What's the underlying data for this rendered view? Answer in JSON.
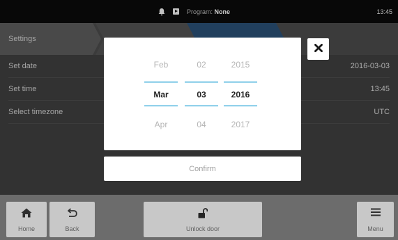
{
  "status_bar": {
    "program_label": "Program:",
    "program_value": "None",
    "time": "13:45",
    "icons": [
      "bell-icon",
      "program-icon"
    ]
  },
  "breadcrumb": {
    "items": [
      {
        "label": "Settings"
      },
      {
        "label": ""
      },
      {
        "label": ""
      }
    ]
  },
  "settings": {
    "rows": [
      {
        "label": "Set date",
        "value": "2016-03-03"
      },
      {
        "label": "Set time",
        "value": "13:45"
      },
      {
        "label": "Select timezone",
        "value": "UTC"
      }
    ]
  },
  "date_picker": {
    "month": {
      "prev": "Feb",
      "current": "Mar",
      "next": "Apr"
    },
    "day": {
      "prev": "02",
      "current": "03",
      "next": "04"
    },
    "year": {
      "prev": "2015",
      "current": "2016",
      "next": "2017"
    },
    "confirm_label": "Confirm",
    "close_icon": "close-icon",
    "accent_color": "#8fd0ea"
  },
  "nav": {
    "home_label": "Home",
    "back_label": "Back",
    "unlock_label": "Unlock door",
    "menu_label": "Menu",
    "icons": [
      "home-icon",
      "back-arrow-icon",
      "unlock-icon",
      "hamburger-menu-icon"
    ]
  }
}
